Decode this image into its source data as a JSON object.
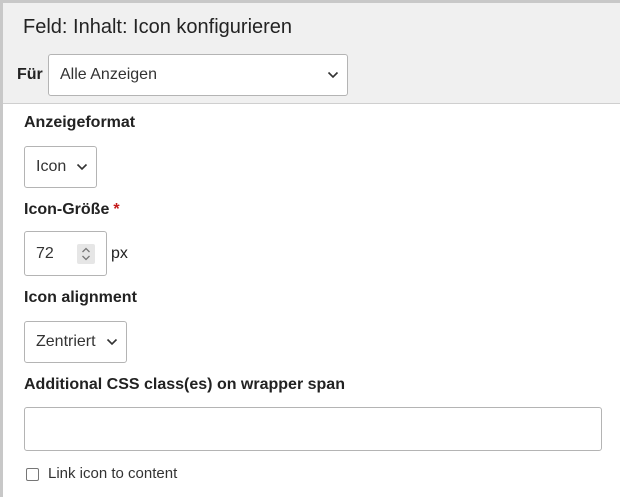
{
  "dialog": {
    "title": "Feld: Inhalt: Icon konfigurieren"
  },
  "for_selector": {
    "label": "Für",
    "selected": "Alle Anzeigen"
  },
  "display_format": {
    "label": "Anzeigeformat",
    "selected": "Icon"
  },
  "icon_size": {
    "label": "Icon-Größe",
    "required_marker": "*",
    "value": "72",
    "unit": "px"
  },
  "icon_alignment": {
    "label": "Icon alignment",
    "selected": "Zentriert"
  },
  "css_class": {
    "label": "Additional CSS class(es) on wrapper span",
    "value": ""
  },
  "link_option": {
    "label": "Link icon to content",
    "checked": false
  },
  "colors": {
    "header_bg": "#f0f0f0",
    "required": "#c41a1a",
    "border": "#b4b4b4"
  }
}
